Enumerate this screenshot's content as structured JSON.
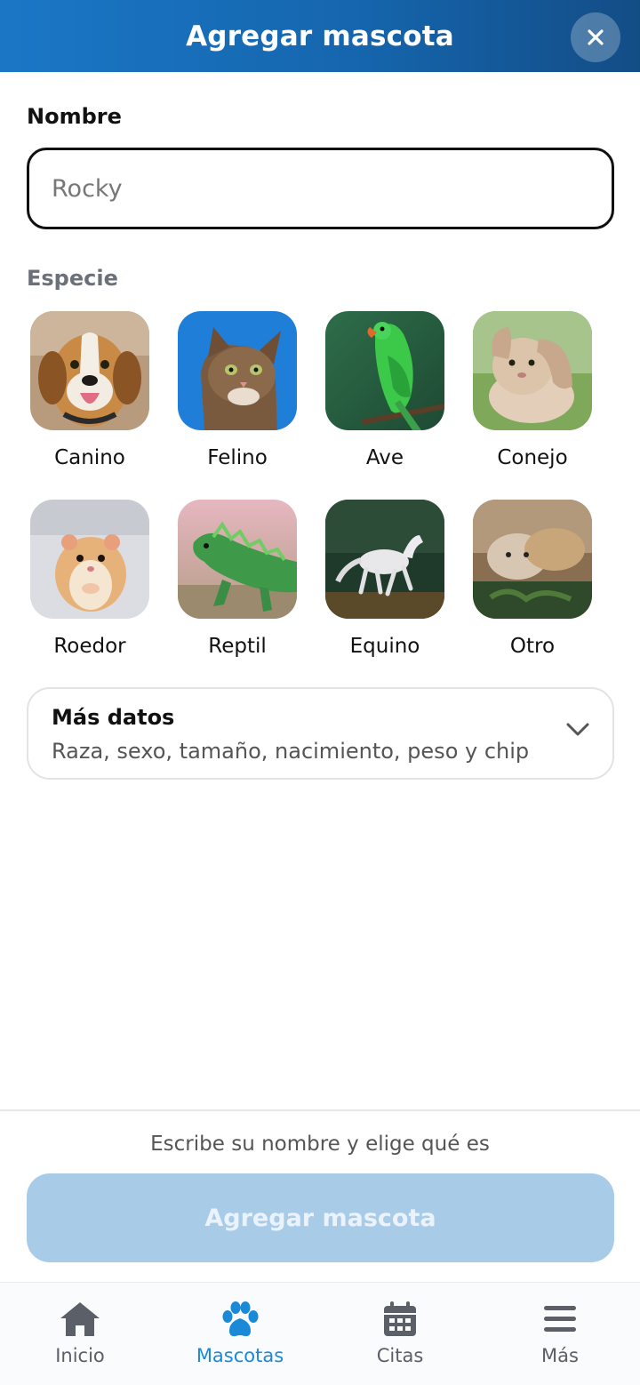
{
  "header": {
    "title": "Agregar mascota",
    "close_icon": "close-icon",
    "close_glyph": "×"
  },
  "form": {
    "name_label": "Nombre",
    "name_placeholder": "Rocky",
    "name_value": "",
    "species_label": "Especie",
    "species": [
      {
        "label": "Canino",
        "icon": "dog-photo"
      },
      {
        "label": "Felino",
        "icon": "cat-photo"
      },
      {
        "label": "Ave",
        "icon": "parrot-photo"
      },
      {
        "label": "Conejo",
        "icon": "rabbit-photo"
      },
      {
        "label": "Roedor",
        "icon": "hamster-photo"
      },
      {
        "label": "Reptil",
        "icon": "iguana-photo"
      },
      {
        "label": "Equino",
        "icon": "horse-photo"
      },
      {
        "label": "Otro",
        "icon": "cat-dog-photo"
      }
    ]
  },
  "more_data": {
    "title": "Más datos",
    "subtitle": "Raza, sexo, tamaño, nacimiento, peso y chip",
    "icon": "chevron-down-icon"
  },
  "footer": {
    "hint": "Escribe su nombre y elige qué es",
    "submit_label": "Agregar mascota"
  },
  "tabbar": {
    "items": [
      {
        "label": "Inicio",
        "icon": "home-icon",
        "active": false
      },
      {
        "label": "Mascotas",
        "icon": "paw-icon",
        "active": true
      },
      {
        "label": "Citas",
        "icon": "calendar-icon",
        "active": false
      },
      {
        "label": "Más",
        "icon": "menu-icon",
        "active": false
      }
    ]
  },
  "colors": {
    "header_start": "#1b77c6",
    "header_end": "#134d86",
    "submit_disabled": "#a8cbe8",
    "tab_active": "#1b8ad6",
    "tab_inactive": "#5a5f68"
  }
}
